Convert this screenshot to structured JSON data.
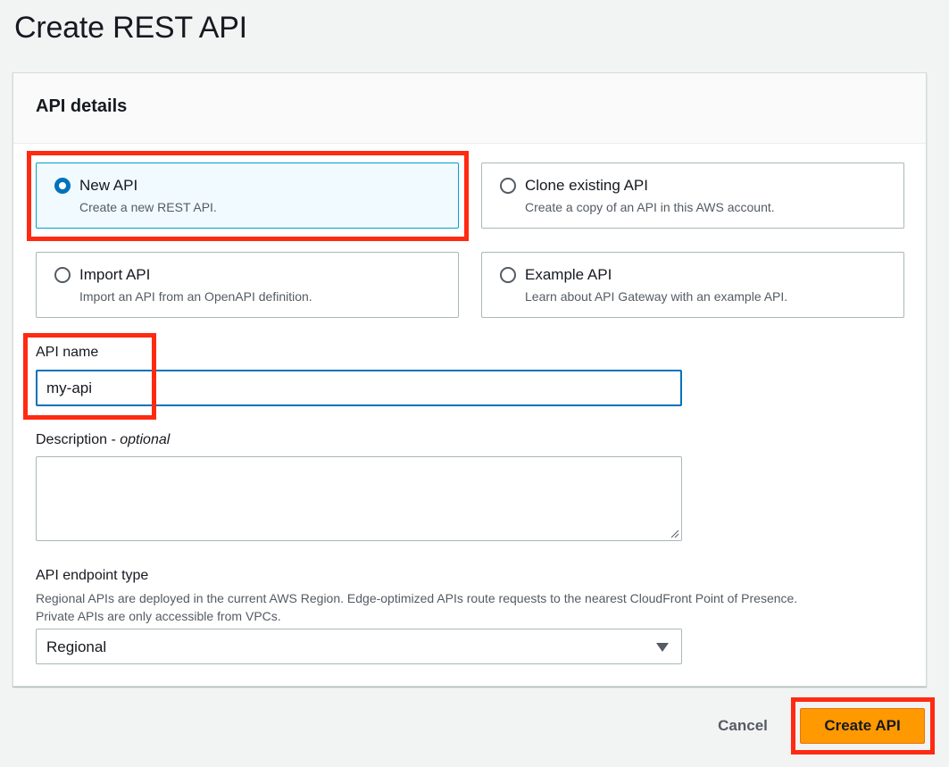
{
  "page": {
    "title": "Create REST API"
  },
  "panel": {
    "title": "API details"
  },
  "api_options": [
    {
      "label": "New API",
      "description": "Create a new REST API.",
      "selected": true
    },
    {
      "label": "Clone existing API",
      "description": "Create a copy of an API in this AWS account.",
      "selected": false
    },
    {
      "label": "Import API",
      "description": "Import an API from an OpenAPI definition.",
      "selected": false
    },
    {
      "label": "Example API",
      "description": "Learn about API Gateway with an example API.",
      "selected": false
    }
  ],
  "api_name": {
    "label": "API name",
    "value": "my-api"
  },
  "description": {
    "label": "Description - ",
    "optional": "optional",
    "value": ""
  },
  "endpoint_type": {
    "label": "API endpoint type",
    "help_line1": "Regional APIs are deployed in the current AWS Region. Edge-optimized APIs route requests to the nearest CloudFront Point of Presence.",
    "help_line2": "Private APIs are only accessible from VPCs.",
    "selected": "Regional"
  },
  "actions": {
    "cancel": "Cancel",
    "create": "Create API"
  },
  "colors": {
    "primary": "#ff9900",
    "selected_border": "#00a1c9",
    "highlight": "#ff2a12"
  }
}
